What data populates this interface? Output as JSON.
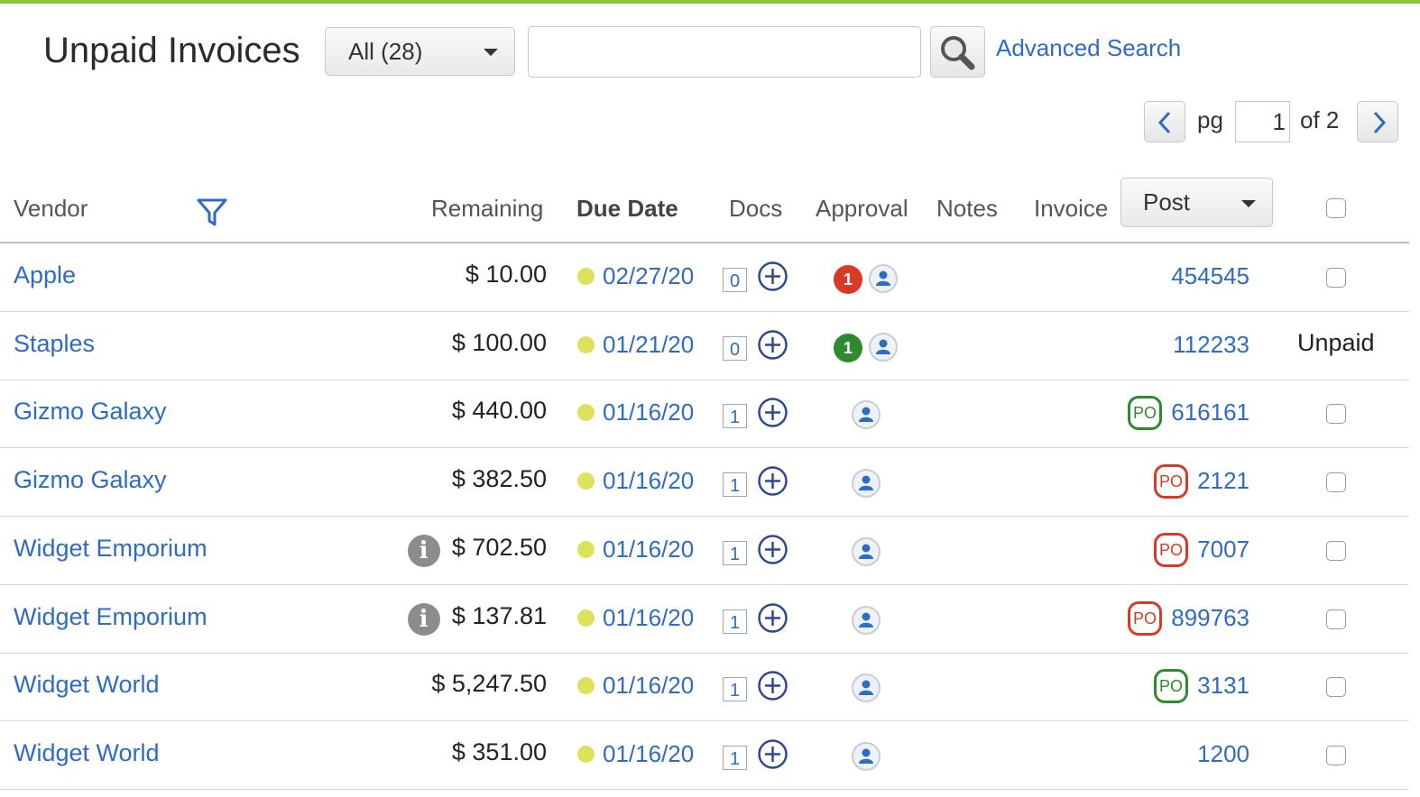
{
  "colors": {
    "accent": "#8dc63f",
    "link": "#2e6bc6",
    "po_green": "#2d8a2d",
    "po_red": "#d93a25",
    "due_dot": "#dce35a"
  },
  "header": {
    "title": "Unpaid Invoices",
    "filter_value": "All (28)",
    "search_placeholder": "",
    "advanced_search_label": "Advanced Search"
  },
  "pager": {
    "pg_label": "pg",
    "current_page": "1",
    "of_label": "of 2"
  },
  "columns": {
    "vendor": "Vendor",
    "remaining": "Remaining",
    "due_date": "Due Date",
    "docs": "Docs",
    "approval": "Approval",
    "notes": "Notes",
    "invoice": "Invoice",
    "post_select": "Post"
  },
  "rows": [
    {
      "vendor": "Apple",
      "remaining": "$ 10.00",
      "info": false,
      "due": "02/27/20",
      "docs": "0",
      "approval_count": "1",
      "approval_color": "red",
      "po": null,
      "invoice": "454545",
      "status": null
    },
    {
      "vendor": "Staples",
      "remaining": "$ 100.00",
      "info": false,
      "due": "01/21/20",
      "docs": "0",
      "approval_count": "1",
      "approval_color": "green",
      "po": null,
      "invoice": "112233",
      "status": "Unpaid"
    },
    {
      "vendor": "Gizmo Galaxy",
      "remaining": "$ 440.00",
      "info": false,
      "due": "01/16/20",
      "docs": "1",
      "approval_count": null,
      "approval_color": null,
      "po": "green",
      "invoice": "616161",
      "status": null
    },
    {
      "vendor": "Gizmo Galaxy",
      "remaining": "$ 382.50",
      "info": false,
      "due": "01/16/20",
      "docs": "1",
      "approval_count": null,
      "approval_color": null,
      "po": "red",
      "invoice": "2121",
      "status": null
    },
    {
      "vendor": "Widget Emporium",
      "remaining": "$ 702.50",
      "info": true,
      "due": "01/16/20",
      "docs": "1",
      "approval_count": null,
      "approval_color": null,
      "po": "red",
      "invoice": "7007",
      "status": null
    },
    {
      "vendor": "Widget Emporium",
      "remaining": "$ 137.81",
      "info": true,
      "due": "01/16/20",
      "docs": "1",
      "approval_count": null,
      "approval_color": null,
      "po": "red",
      "invoice": "899763",
      "status": null
    },
    {
      "vendor": "Widget World",
      "remaining": "$ 5,247.50",
      "info": false,
      "due": "01/16/20",
      "docs": "1",
      "approval_count": null,
      "approval_color": null,
      "po": "green",
      "invoice": "3131",
      "status": null
    },
    {
      "vendor": "Widget World",
      "remaining": "$ 351.00",
      "info": false,
      "due": "01/16/20",
      "docs": "1",
      "approval_count": null,
      "approval_color": null,
      "po": null,
      "invoice": "1200",
      "status": null
    }
  ],
  "po_label": "PO",
  "info_glyph": "i",
  "icons": {
    "search": "search-icon",
    "filter": "filter-funnel-icon",
    "prev": "chevron-left-icon",
    "next": "chevron-right-icon",
    "add": "plus-circle-icon",
    "approver": "person-icon",
    "info": "info-icon"
  }
}
